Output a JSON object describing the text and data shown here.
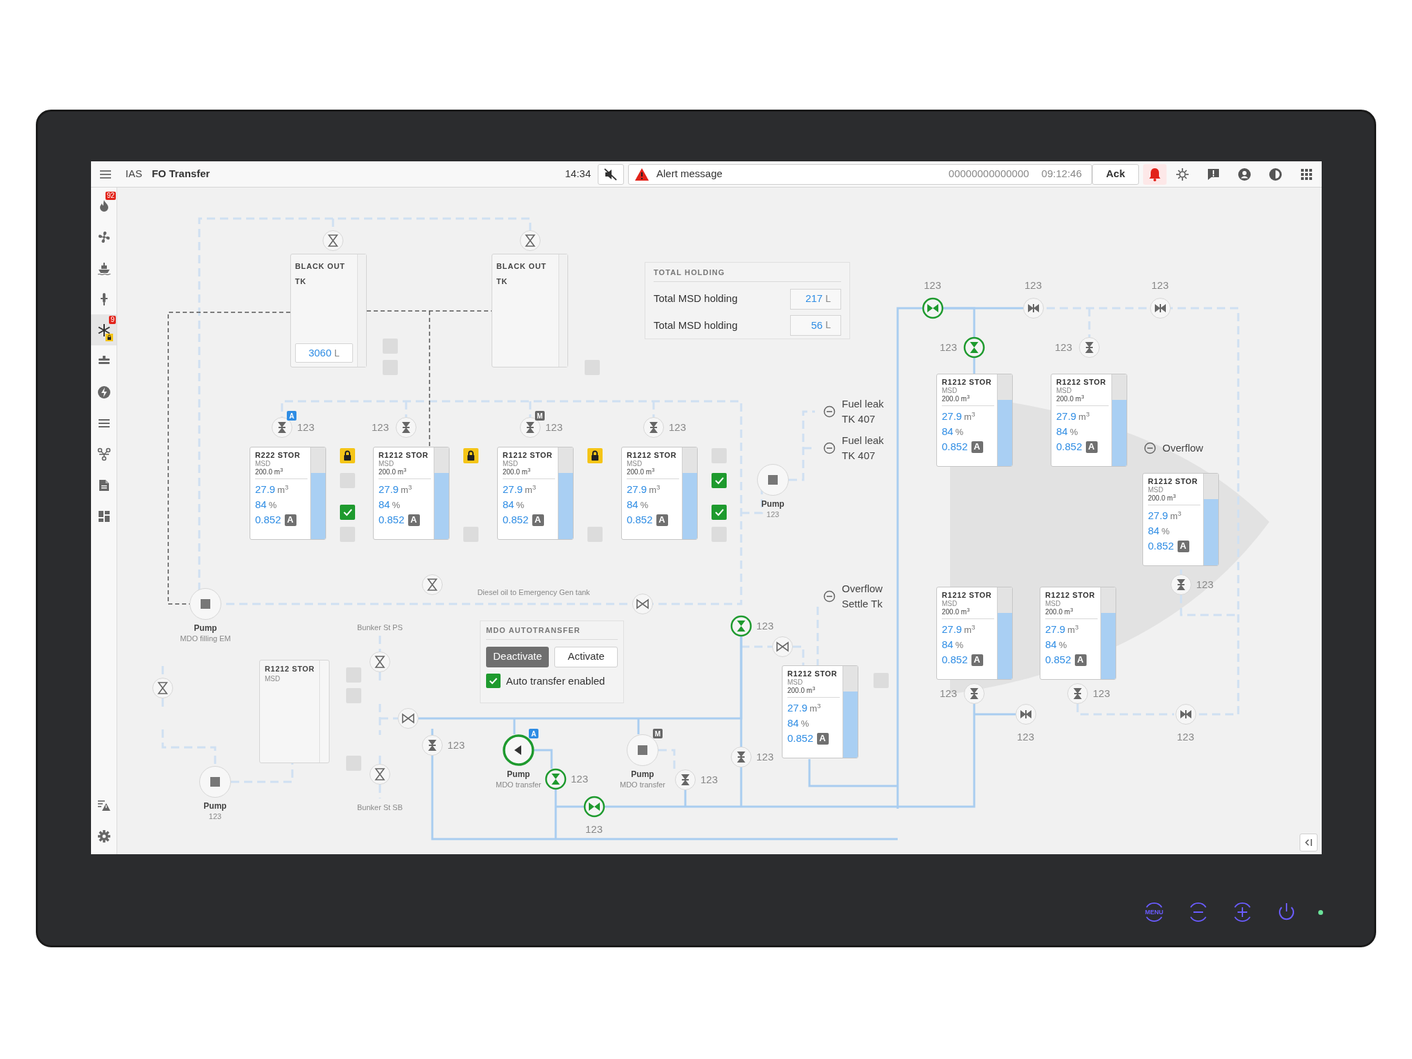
{
  "top_bar": {
    "app": "IAS",
    "title": "FO Transfer",
    "time": "14:34",
    "muted": true,
    "alert": {
      "message": "Alert message",
      "code": "00000000000000",
      "time": "09:12:46"
    },
    "ack": "Ack",
    "bell_active": true
  },
  "sidebar": [
    {
      "badge": "92",
      "selected": false,
      "locked": false
    },
    {
      "selected": false,
      "locked": false
    },
    {
      "selected": false,
      "locked": false
    },
    {
      "selected": false,
      "locked": false
    },
    {
      "badge": "9",
      "selected": true,
      "locked": true
    },
    {
      "selected": false,
      "locked": false
    },
    {
      "selected": false,
      "locked": false
    },
    {
      "selected": false,
      "locked": false
    },
    {
      "selected": false,
      "locked": false
    },
    {
      "selected": false,
      "locked": false
    },
    {
      "selected": false,
      "locked": false
    }
  ],
  "black_out_tanks": [
    {
      "title": "BLACK OUT TK",
      "value": "3060",
      "unit": "L"
    },
    {
      "title": "BLACK OUT TK"
    }
  ],
  "total_holding": {
    "title": "TOTAL HOLDING",
    "rows": [
      {
        "label": "Total MSD holding",
        "value": "217",
        "unit": "L"
      },
      {
        "label": "Total MSD holding",
        "value": "56",
        "unit": "L"
      }
    ]
  },
  "tanks": [
    {
      "name": "R222 STOR",
      "medium": "MSD",
      "capacity": "200.0 m$^{3}$",
      "volume": "27.9",
      "volume_unit": "m$^{3}$",
      "percent": "84",
      "percent_unit": "%",
      "density": "0.852",
      "mode": "A",
      "level": 0.72,
      "indicators": [
        {
          "kind": "lock"
        },
        {
          "kind": "blank"
        },
        {
          "kind": "check"
        },
        {
          "kind": "blank"
        }
      ]
    },
    {
      "name": "R1212 STOR",
      "medium": "MSD",
      "capacity": "200.0 m$^{3}$",
      "volume": "27.9",
      "volume_unit": "m$^{3}$",
      "percent": "84",
      "percent_unit": "%",
      "density": "0.852",
      "mode": "A",
      "level": 0.72,
      "indicators": [
        {
          "kind": "lock"
        },
        {
          "kind": "none"
        },
        {
          "kind": "none"
        },
        {
          "kind": "blank"
        }
      ]
    },
    {
      "name": "R1212 STOR",
      "medium": "MSD",
      "capacity": "200.0 m$^{3}$",
      "volume": "27.9",
      "volume_unit": "m$^{3}$",
      "percent": "84",
      "percent_unit": "%",
      "density": "0.852",
      "mode": "A",
      "level": 0.72,
      "indicators": [
        {
          "kind": "lock"
        },
        {
          "kind": "none"
        },
        {
          "kind": "none"
        },
        {
          "kind": "blank"
        }
      ]
    },
    {
      "name": "R1212 STOR",
      "medium": "MSD",
      "capacity": "200.0 m$^{3}$",
      "volume": "27.9",
      "volume_unit": "m$^{3}$",
      "percent": "84",
      "percent_unit": "%",
      "density": "0.852",
      "mode": "A",
      "level": 0.72,
      "indicators": [
        {
          "kind": "blank"
        },
        {
          "kind": "check"
        },
        {
          "kind": "check"
        },
        {
          "kind": "blank"
        }
      ]
    },
    {
      "name": "R1212 STOR",
      "medium": "MSD",
      "capacity": "200.0 m$^{3}$",
      "volume": "27.9",
      "volume_unit": "m$^{3}$",
      "percent": "84",
      "percent_unit": "%",
      "density": "0.852",
      "mode": "A",
      "level": 0.72
    },
    {
      "name": "R1212 STOR",
      "medium": "MSD",
      "capacity": "200.0 m$^{3}$",
      "volume": "27.9",
      "volume_unit": "m$^{3}$",
      "percent": "84",
      "percent_unit": "%",
      "density": "0.852",
      "mode": "A",
      "level": 0.72
    },
    {
      "name": "R1212 STOR",
      "medium": "MSD",
      "capacity": "200.0 m$^{3}$",
      "volume": "27.9",
      "volume_unit": "m$^{3}$",
      "percent": "84",
      "percent_unit": "%",
      "density": "0.852",
      "mode": "A",
      "level": 0.72
    },
    {
      "name": "R1212 STOR",
      "medium": "MSD",
      "capacity": "200.0 m$^{3}$",
      "volume": "27.9",
      "volume_unit": "m$^{3}$",
      "percent": "84",
      "percent_unit": "%",
      "density": "0.852",
      "mode": "A",
      "level": 0.72
    },
    {
      "name": "R1212 STOR",
      "medium": "MSD",
      "capacity": "200.0 m$^{3}$",
      "volume": "27.9",
      "volume_unit": "m$^{3}$",
      "percent": "84",
      "percent_unit": "%",
      "density": "0.852",
      "mode": "A",
      "level": 0.72
    },
    {
      "name": "R1212 STOR",
      "medium": "MSD",
      "capacity": "200.0 m$^{3}$",
      "volume": "27.9",
      "volume_unit": "m$^{3}$",
      "percent": "84",
      "percent_unit": "%",
      "density": "0.852",
      "mode": "A",
      "level": 0.72
    }
  ],
  "empty_tank": {
    "name": "R1212 STOR",
    "medium": "MSD"
  },
  "valves": [
    {
      "kind": "manual",
      "open": false
    },
    {
      "kind": "manual",
      "open": false
    },
    {
      "kind": "actuated",
      "open": false,
      "label": "123",
      "badge": "A"
    },
    {
      "kind": "actuated",
      "open": false,
      "label": "123"
    },
    {
      "kind": "actuated",
      "open": false,
      "label": "123",
      "badge": "M"
    },
    {
      "kind": "actuated",
      "open": false,
      "label": "123"
    },
    {
      "kind": "manual",
      "open": false
    },
    {
      "kind": "check",
      "open": false
    },
    {
      "kind": "butterfly",
      "open": true,
      "label": "123"
    },
    {
      "kind": "butterfly",
      "open": false,
      "label": "123"
    },
    {
      "kind": "butterfly",
      "open": false,
      "label": "123"
    },
    {
      "kind": "actuated",
      "open": true,
      "label": "123"
    },
    {
      "kind": "actuated",
      "open": false,
      "label": "123"
    },
    {
      "kind": "actuated",
      "open": false,
      "label": "123"
    },
    {
      "kind": "actuated",
      "open": true,
      "label": "123"
    },
    {
      "kind": "check",
      "open": false
    },
    {
      "kind": "manual",
      "open": false
    },
    {
      "kind": "manual",
      "open": false
    },
    {
      "kind": "manual",
      "open": false
    },
    {
      "kind": "check",
      "open": false
    },
    {
      "kind": "actuated",
      "open": false,
      "label": "123"
    },
    {
      "kind": "actuated",
      "open": false,
      "label": "123"
    },
    {
      "kind": "actuated",
      "open": true,
      "label": "123"
    },
    {
      "kind": "actuated",
      "open": false,
      "label": "123"
    },
    {
      "kind": "butterfly",
      "open": true,
      "label": "123"
    },
    {
      "kind": "actuated",
      "open": false,
      "label": "123"
    },
    {
      "kind": "actuated",
      "open": false,
      "label": "123"
    },
    {
      "kind": "butterfly",
      "open": false,
      "label": "123"
    },
    {
      "kind": "butterfly",
      "open": false,
      "label": "123"
    }
  ],
  "pumps": [
    {
      "name": "Pump",
      "description": "MDO filling EM",
      "running": false
    },
    {
      "name": "Pump",
      "description": "123",
      "running": false
    },
    {
      "name": "Pump",
      "description": "123",
      "running": false
    },
    {
      "name": "Pump",
      "description": "MDO transfer",
      "running": true,
      "badge": "A"
    },
    {
      "name": "Pump",
      "description": "MDO transfer",
      "running": false,
      "badge": "M"
    }
  ],
  "alarms": [
    {
      "text": "Fuel leak TK 407"
    },
    {
      "text": "Fuel leak TK 407"
    },
    {
      "text": "Overflow"
    },
    {
      "text": "Overflow Settle Tk"
    }
  ],
  "line_labels": [
    "Diesel oil to Emergency Gen tank",
    "Bunker St PS",
    "Bunker St SB"
  ],
  "autotransfer": {
    "title": "MDO AUTOTRANSFER",
    "buttons": [
      {
        "label": "Deactivate",
        "selected": true
      },
      {
        "label": "Activate",
        "selected": false
      }
    ],
    "checkbox": {
      "label": "Auto transfer enabled",
      "checked": true
    }
  },
  "bezel": {
    "menu": "MENU",
    "power_led": true
  }
}
